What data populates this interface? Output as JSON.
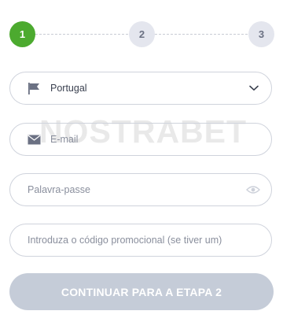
{
  "stepper": {
    "steps": [
      {
        "number": "1",
        "state": "active"
      },
      {
        "number": "2",
        "state": "inactive"
      },
      {
        "number": "3",
        "state": "inactive"
      }
    ]
  },
  "form": {
    "country": {
      "value": "Portugal",
      "icon": "flag-icon"
    },
    "email": {
      "placeholder": "E-mail",
      "icon": "envelope-icon"
    },
    "password": {
      "placeholder": "Palavra-passe",
      "icon": "eye-icon"
    },
    "promo": {
      "placeholder": "Introduza o código promocional (se tiver um)"
    },
    "submit_label": "CONTINUAR PARA A ETAPA 2"
  },
  "watermark": "NOSTRABET",
  "colors": {
    "accent_green": "#4caa2f",
    "inactive_step": "#e4e6ee",
    "border": "#cfd3dc",
    "button_disabled": "#c5ccd8"
  }
}
